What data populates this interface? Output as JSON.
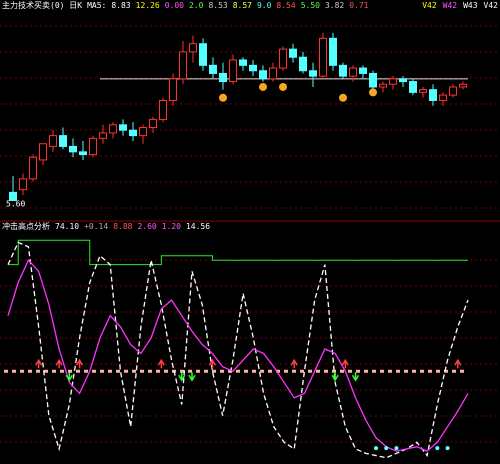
{
  "top_header": {
    "items": [
      {
        "text": "主力技术买卖(0) 日K",
        "color": "#ffffff"
      },
      {
        "text": "MA5:",
        "color": "#ffffff"
      },
      {
        "text": "8.83",
        "color": "#ffffff"
      },
      {
        "text": "12.26",
        "color": "#ffff00"
      },
      {
        "text": "0.00",
        "color": "#ff55ff"
      },
      {
        "text": "2.0",
        "color": "#55ff55"
      },
      {
        "text": "8.53",
        "color": "#cccccc"
      },
      {
        "text": "8.57",
        "color": "#ffff55"
      },
      {
        "text": "9.0",
        "color": "#55ffff"
      },
      {
        "text": "8.54",
        "color": "#ff5555"
      },
      {
        "text": "5.50",
        "color": "#55ff55"
      },
      {
        "text": "3.82",
        "color": "#cccccc"
      },
      {
        "text": "0.71",
        "color": "#ff5555"
      }
    ],
    "right_flags": [
      {
        "text": "V42",
        "color": "#ffff00"
      },
      {
        "text": "W42",
        "color": "#ff55ff"
      },
      {
        "text": "W43",
        "color": "#ffffff"
      },
      {
        "text": "V42",
        "color": "#ffffff"
      }
    ]
  },
  "bottom_header": {
    "items": [
      {
        "text": "冲击高点分析",
        "color": "#ffffff"
      },
      {
        "text": "74.10",
        "color": "#ffffff"
      },
      {
        "text": "+0.14",
        "color": "#aaaaaa"
      },
      {
        "text": "8.88",
        "color": "#ff5555"
      },
      {
        "text": "2.60",
        "color": "#ff55ff"
      },
      {
        "text": "1.20",
        "color": "#ff55ff"
      },
      {
        "text": "14.56",
        "color": "#ffffff"
      }
    ]
  },
  "chart_data": [
    {
      "type": "candlestick",
      "panel": "price",
      "price_label": "5.60",
      "hline": 10.0,
      "ylim": [
        5.0,
        12.4
      ],
      "up_color": "#ff3030",
      "down_color": "#54ffff",
      "ohlc": [
        [
          5.8,
          6.4,
          5.5,
          5.5
        ],
        [
          5.9,
          6.5,
          5.7,
          6.3
        ],
        [
          6.3,
          7.2,
          6.2,
          7.1
        ],
        [
          7.0,
          7.6,
          6.8,
          7.6
        ],
        [
          7.5,
          8.1,
          7.3,
          7.9
        ],
        [
          7.9,
          8.2,
          7.4,
          7.5
        ],
        [
          7.5,
          7.8,
          7.1,
          7.3
        ],
        [
          7.3,
          7.7,
          7.0,
          7.2
        ],
        [
          7.2,
          7.9,
          7.1,
          7.8
        ],
        [
          7.8,
          8.3,
          7.6,
          8.0
        ],
        [
          8.0,
          8.4,
          7.8,
          8.3
        ],
        [
          8.3,
          8.5,
          7.9,
          8.1
        ],
        [
          8.1,
          8.4,
          7.7,
          7.9
        ],
        [
          7.9,
          8.3,
          7.6,
          8.2
        ],
        [
          8.2,
          8.6,
          8.0,
          8.5
        ],
        [
          8.5,
          9.3,
          8.4,
          9.2
        ],
        [
          9.2,
          10.2,
          9.0,
          10.0
        ],
        [
          10.0,
          11.4,
          9.8,
          11.0
        ],
        [
          11.0,
          11.6,
          10.6,
          11.3
        ],
        [
          11.3,
          11.5,
          10.3,
          10.5
        ],
        [
          10.5,
          10.8,
          10.0,
          10.2
        ],
        [
          10.2,
          10.6,
          9.6,
          9.9
        ],
        [
          9.9,
          10.9,
          9.8,
          10.7
        ],
        [
          10.7,
          10.8,
          10.3,
          10.5
        ],
        [
          10.5,
          10.7,
          10.1,
          10.3
        ],
        [
          10.3,
          10.5,
          9.9,
          10.0
        ],
        [
          10.0,
          10.6,
          9.9,
          10.4
        ],
        [
          10.4,
          11.2,
          10.3,
          11.1
        ],
        [
          11.1,
          11.3,
          10.6,
          10.8
        ],
        [
          10.8,
          11.0,
          10.2,
          10.3
        ],
        [
          10.3,
          10.6,
          9.7,
          10.1
        ],
        [
          10.1,
          11.7,
          10.0,
          11.5
        ],
        [
          11.5,
          11.7,
          10.3,
          10.5
        ],
        [
          10.5,
          10.6,
          10.0,
          10.1
        ],
        [
          10.1,
          10.5,
          9.9,
          10.4
        ],
        [
          10.4,
          10.5,
          10.0,
          10.2
        ],
        [
          10.2,
          10.3,
          9.6,
          9.7
        ],
        [
          9.7,
          9.9,
          9.5,
          9.8
        ],
        [
          9.8,
          10.1,
          9.6,
          10.0
        ],
        [
          10.0,
          10.1,
          9.7,
          9.9
        ],
        [
          9.9,
          10.0,
          9.4,
          9.5
        ],
        [
          9.5,
          9.7,
          9.3,
          9.6
        ],
        [
          9.6,
          9.8,
          9.0,
          9.2
        ],
        [
          9.2,
          9.5,
          9.0,
          9.4
        ],
        [
          9.4,
          9.8,
          9.3,
          9.7
        ],
        [
          9.7,
          9.9,
          9.6,
          9.8
        ]
      ],
      "markers": [
        {
          "index": 21,
          "price": 9.3
        },
        {
          "index": 25,
          "price": 9.7
        },
        {
          "index": 27,
          "price": 9.7
        },
        {
          "index": 33,
          "price": 9.3
        },
        {
          "index": 36,
          "price": 9.5
        }
      ]
    },
    {
      "type": "line",
      "panel": "indicator",
      "ylim": [
        0,
        100
      ],
      "x": [
        0,
        1,
        2,
        3,
        4,
        5,
        6,
        7,
        8,
        9,
        10,
        11,
        12,
        13,
        14,
        15,
        16,
        17,
        18,
        19,
        20,
        21,
        22,
        23,
        24,
        25,
        26,
        27,
        28,
        29,
        30,
        31,
        32,
        33,
        34,
        35,
        36,
        37,
        38,
        39,
        40,
        41,
        42,
        43,
        44,
        45
      ],
      "dashed_level": 40,
      "series": [
        {
          "color": "#ffffff",
          "style": "dashed",
          "values": [
            88,
            98,
            96,
            60,
            20,
            5,
            25,
            55,
            80,
            92,
            88,
            40,
            15,
            60,
            90,
            70,
            45,
            25,
            85,
            70,
            40,
            20,
            45,
            75,
            55,
            30,
            15,
            8,
            5,
            40,
            72,
            88,
            35,
            15,
            5,
            3,
            2,
            1,
            3,
            5,
            8,
            2,
            25,
            45,
            60,
            72
          ]
        },
        {
          "color": "#ff33ff",
          "style": "solid",
          "values": [
            65,
            80,
            90,
            85,
            70,
            50,
            35,
            30,
            40,
            55,
            65,
            60,
            52,
            48,
            55,
            68,
            72,
            65,
            58,
            52,
            48,
            42,
            40,
            45,
            50,
            48,
            42,
            35,
            28,
            30,
            40,
            50,
            48,
            40,
            28,
            18,
            10,
            6,
            4,
            5,
            6,
            4,
            8,
            15,
            22,
            30
          ]
        }
      ],
      "step_line": {
        "color": "#2ee82e",
        "values": [
          88,
          99,
          99,
          99,
          99,
          99,
          99,
          99,
          88,
          88,
          88,
          88,
          88,
          88,
          88,
          92,
          92,
          92,
          92,
          92,
          90,
          90,
          90,
          90,
          90,
          90,
          90,
          90,
          90,
          90,
          90,
          90,
          90,
          90,
          90,
          90,
          90,
          90,
          90,
          90,
          90,
          90,
          90,
          90,
          90,
          90
        ]
      },
      "red_arrows": [
        3,
        5,
        7,
        15,
        20,
        28,
        33,
        44
      ],
      "green_arrows": [
        6,
        17,
        18,
        32,
        34
      ],
      "cyan_dots": [
        36,
        37,
        38,
        42,
        43
      ]
    }
  ]
}
